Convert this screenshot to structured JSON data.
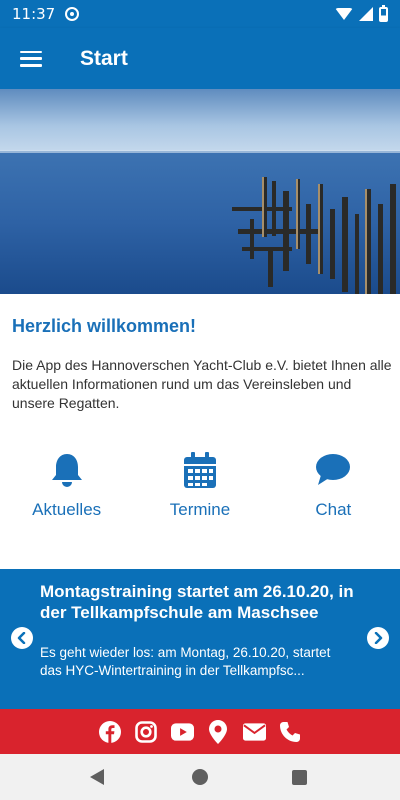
{
  "status_bar": {
    "time": "11:37"
  },
  "app_bar": {
    "title": "Start"
  },
  "welcome": {
    "title": "Herzlich willkommen!",
    "text": "Die App des Hannoverschen Yacht-Club e.V. bietet Ihnen alle aktuellen Informationen rund um das Vereinsleben und unsere Regatten."
  },
  "quick_nav": [
    {
      "label": "Aktuelles",
      "icon": "bell-icon"
    },
    {
      "label": "Termine",
      "icon": "calendar-icon"
    },
    {
      "label": "Chat",
      "icon": "chat-bubble-icon"
    }
  ],
  "news": {
    "headline": "Montagstraining startet am 26.10.20, in der Tellkampfschule am Maschsee",
    "teaser": "Es geht wieder los: am Montag, 26.10.20, startet das HYC-Wintertraining in der Tellkampfsc..."
  },
  "social_icons": [
    "facebook-icon",
    "instagram-icon",
    "youtube-icon",
    "location-pin-icon",
    "mail-icon",
    "phone-icon"
  ],
  "colors": {
    "primary": "#0a70b8",
    "accent": "#1a70b8",
    "social_bar": "#d9232d"
  }
}
